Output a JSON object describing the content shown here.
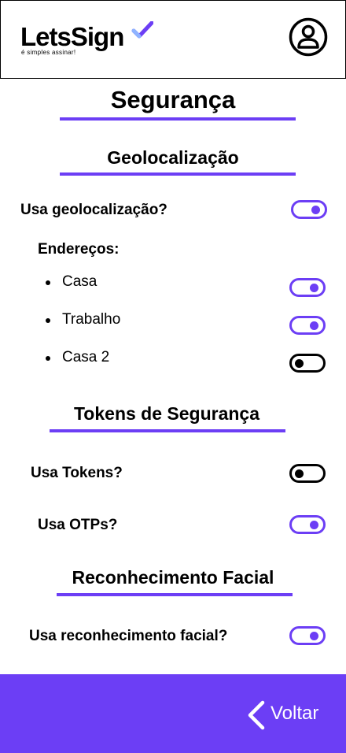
{
  "header": {
    "logo_text": "LetsSign",
    "logo_tagline": "é simples assinar!",
    "profile_icon": "user-circle-icon"
  },
  "colors": {
    "accent": "#6c3ef5",
    "toggle_off": "#000000"
  },
  "page": {
    "title": "Segurança"
  },
  "geolocation": {
    "section_title": "Geolocalização",
    "use_label": "Usa geolocalização?",
    "use_enabled": true,
    "addresses_label": "Endereços:",
    "addresses": [
      {
        "name": "Casa",
        "enabled": true
      },
      {
        "name": "Trabalho",
        "enabled": true
      },
      {
        "name": "Casa 2",
        "enabled": false
      }
    ]
  },
  "tokens": {
    "section_title": "Tokens de Segurança",
    "use_tokens_label": "Usa Tokens?",
    "use_tokens_enabled": false,
    "use_otps_label": "Usa OTPs?",
    "use_otps_enabled": true
  },
  "facial": {
    "section_title": "Reconhecimento Facial",
    "use_label": "Usa reconhecimento facial?",
    "use_enabled": true
  },
  "footer": {
    "back_label": "Voltar",
    "back_icon": "chevron-left-icon"
  }
}
